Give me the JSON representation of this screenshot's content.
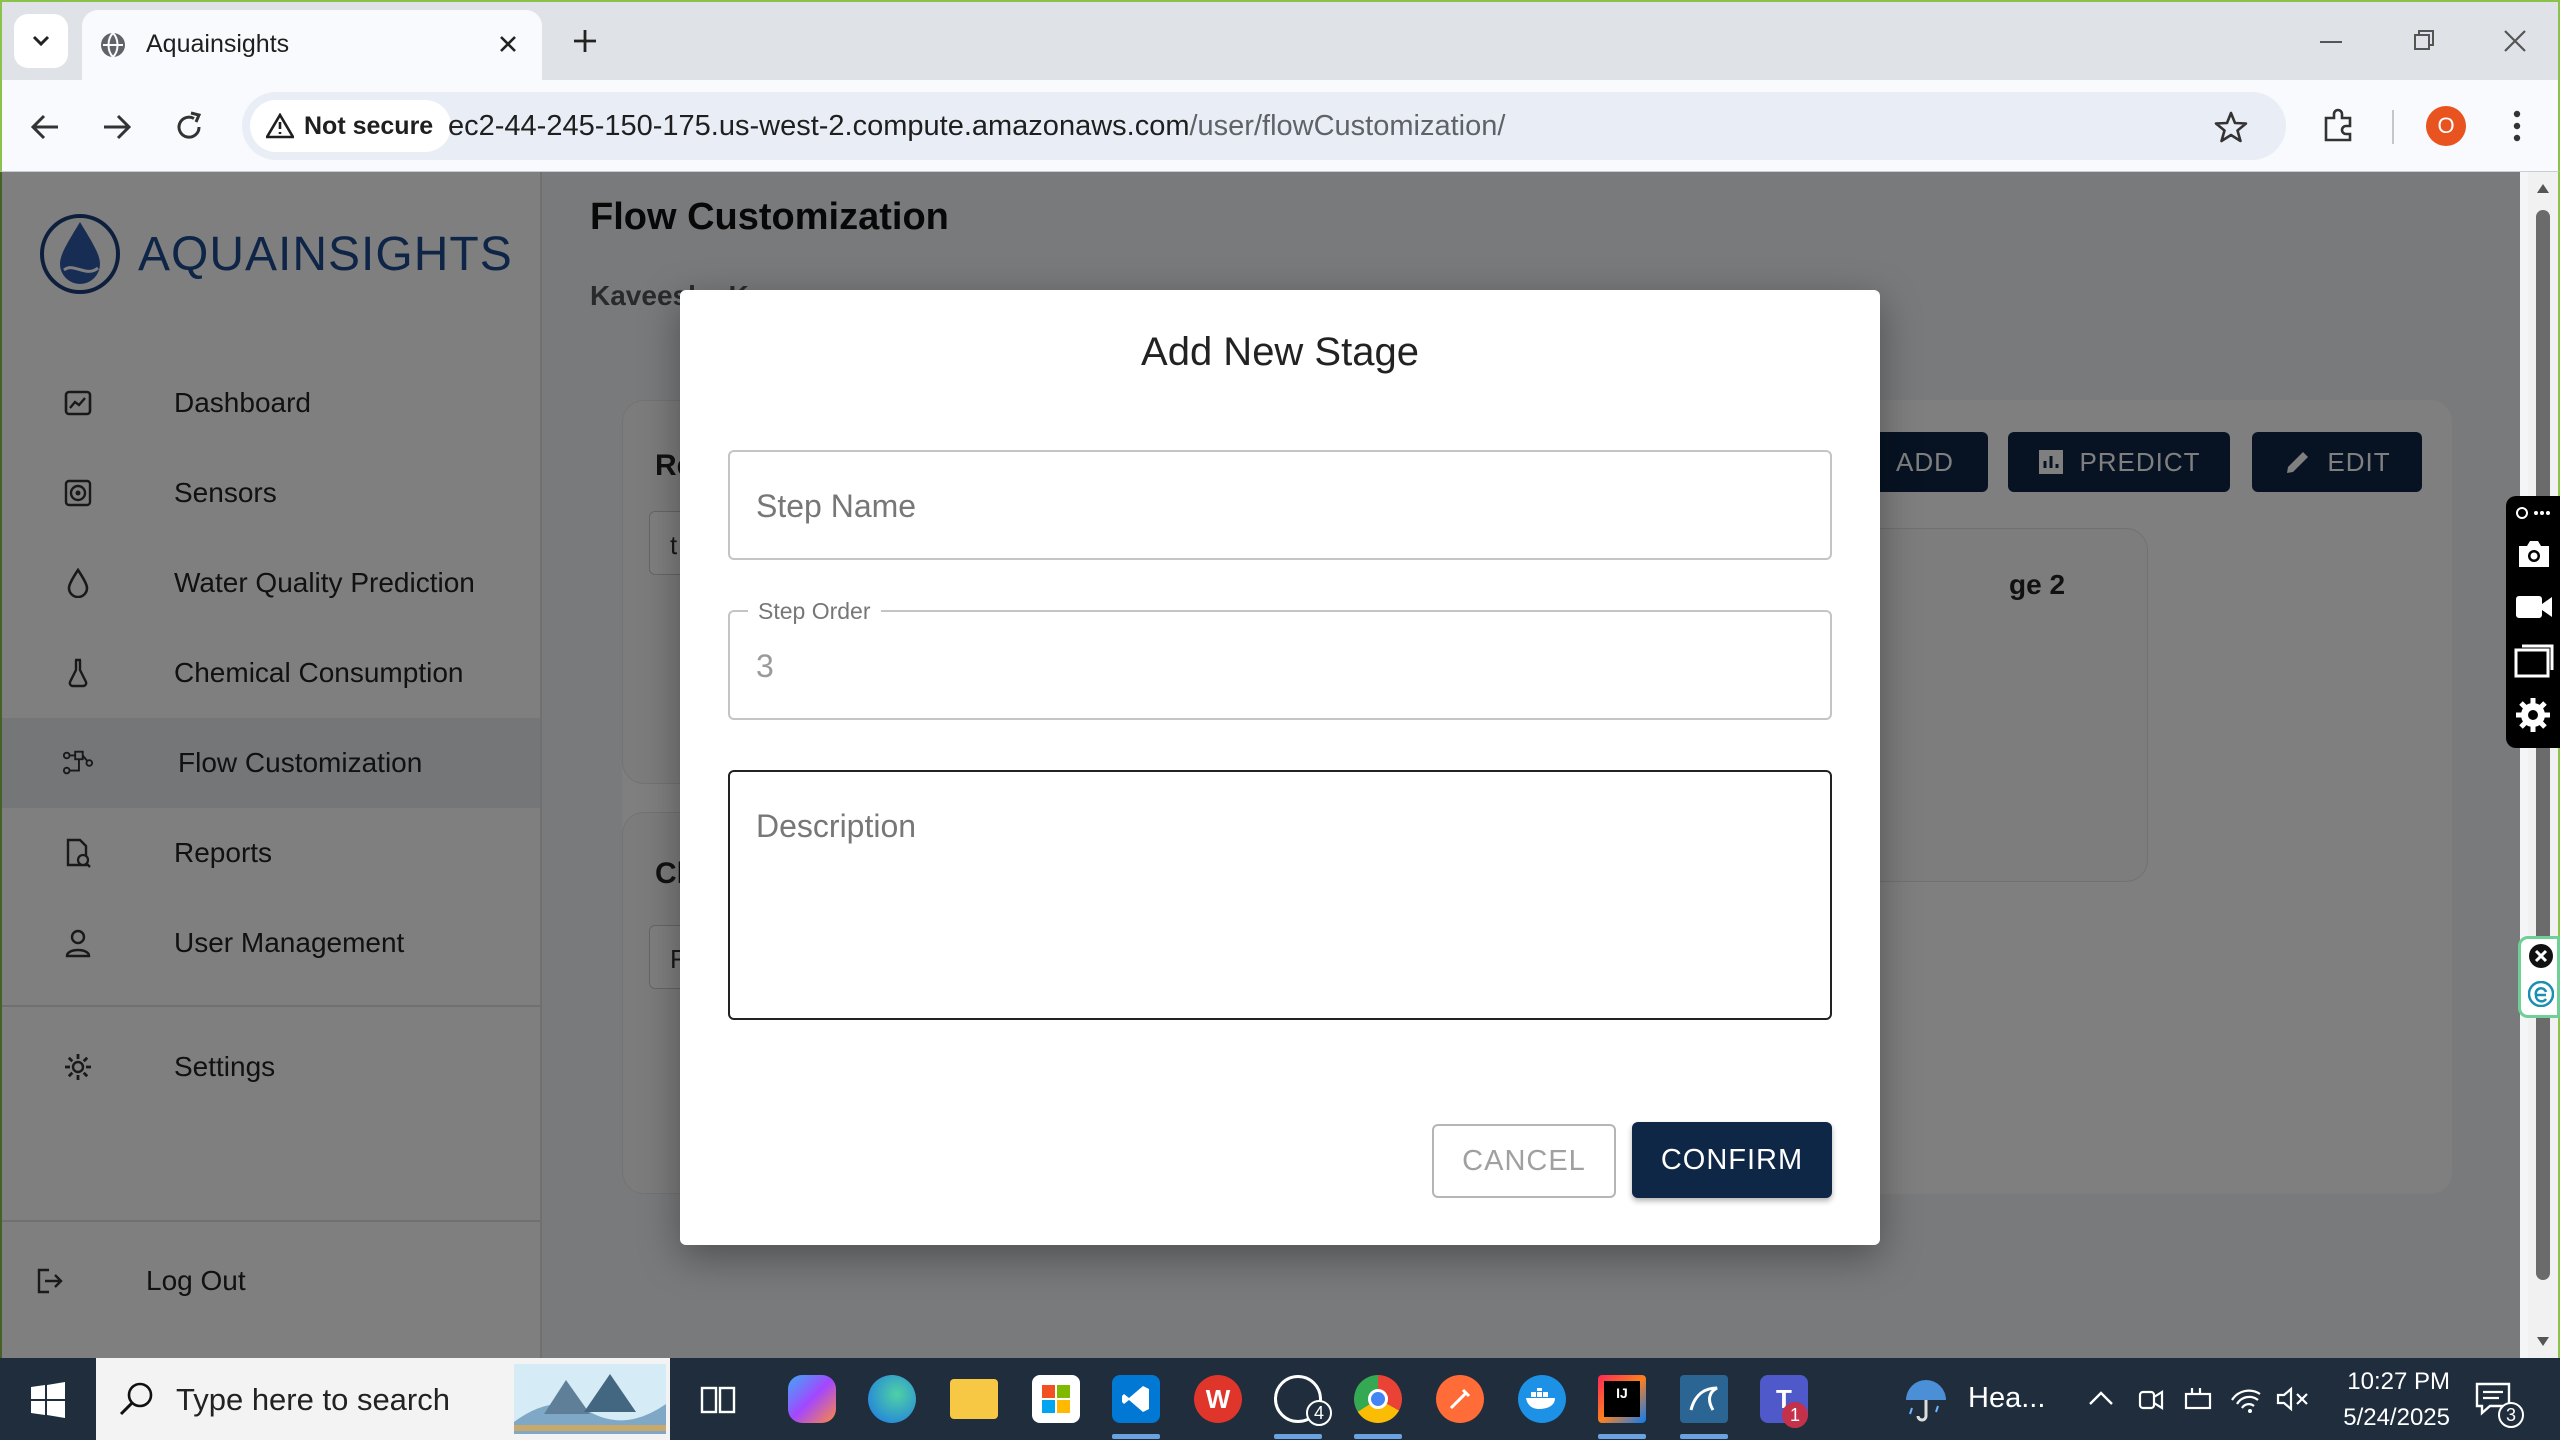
{
  "browser": {
    "tab_title": "Aquainsights",
    "security_label": "Not secure",
    "url_host": "ec2-44-245-150-175.us-west-2.compute.amazonaws.com",
    "url_path": "/user/flowCustomization/",
    "profile_initial": "O"
  },
  "sidebar": {
    "logo_text": "AQUAINSIGHTS",
    "items": [
      {
        "label": "Dashboard",
        "icon": "dashboard-icon"
      },
      {
        "label": "Sensors",
        "icon": "sensor-icon"
      },
      {
        "label": "Water Quality Prediction",
        "icon": "water-drop-icon"
      },
      {
        "label": "Chemical Consumption",
        "icon": "flask-icon"
      },
      {
        "label": "Flow Customization",
        "icon": "flow-icon",
        "active": true
      },
      {
        "label": "Reports",
        "icon": "report-icon"
      },
      {
        "label": "User Management",
        "icon": "user-icon"
      }
    ],
    "settings_label": "Settings",
    "logout_label": "Log Out"
  },
  "main": {
    "title": "Flow Customization",
    "subtitle": "Kaveesha K",
    "card1_heading": "Re",
    "card1_field": "t",
    "card2_heading": "Ch",
    "card2_field": "F",
    "stage_label": "ge 2",
    "add_label": "ADD",
    "predict_label": "PREDICT",
    "edit_label": "EDIT"
  },
  "dialog": {
    "title": "Add New Stage",
    "step_name_placeholder": "Step Name",
    "step_order_label": "Step Order",
    "step_order_value": "3",
    "description_placeholder": "Description",
    "cancel_label": "CANCEL",
    "confirm_label": "CONFIRM"
  },
  "taskbar": {
    "search_placeholder": "Type here to search",
    "whatsapp_badge": "4",
    "teams_badge": "1",
    "weather_text": "Hea...",
    "time": "10:27 PM",
    "date": "5/24/2025",
    "notifications_badge": "3"
  }
}
